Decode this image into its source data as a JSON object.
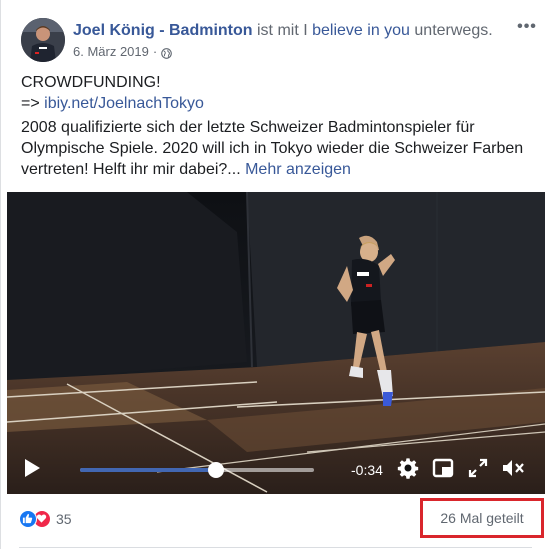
{
  "post": {
    "author": "Joel König - Badminton",
    "author_suffix": " ist mit I ",
    "feeling_label": "believe in you",
    "feeling_suffix": " unterwegs.",
    "date": "6. März 2019",
    "date_separator": "·",
    "privacy_icon": "globe-icon",
    "more_label": "•••",
    "headline": "CROWDFUNDING!",
    "link_prefix": "=> ",
    "link_text": "ibiy.net/JoelnachTokyo",
    "paragraph": "2008 qualifizierte sich der letzte Schweizer Badmintonspieler für Olympische Spiele. 2020 will ich in Tokyo wieder die Schweizer Farben vertreten! Helft ihr mir dabei?...",
    "see_more": "Mehr anzeigen"
  },
  "video": {
    "time_remaining": "-0:34",
    "progress": 0.58,
    "accent_color": "#4267b2",
    "icons": [
      "play-icon",
      "gear-icon",
      "mini-player-icon",
      "fullscreen-icon",
      "volume-icon"
    ]
  },
  "footer": {
    "reaction_icons": [
      "like-icon",
      "love-icon"
    ],
    "reaction_count": "35",
    "share_count": "26 Mal geteilt",
    "highlight_color": "#d9262c"
  }
}
